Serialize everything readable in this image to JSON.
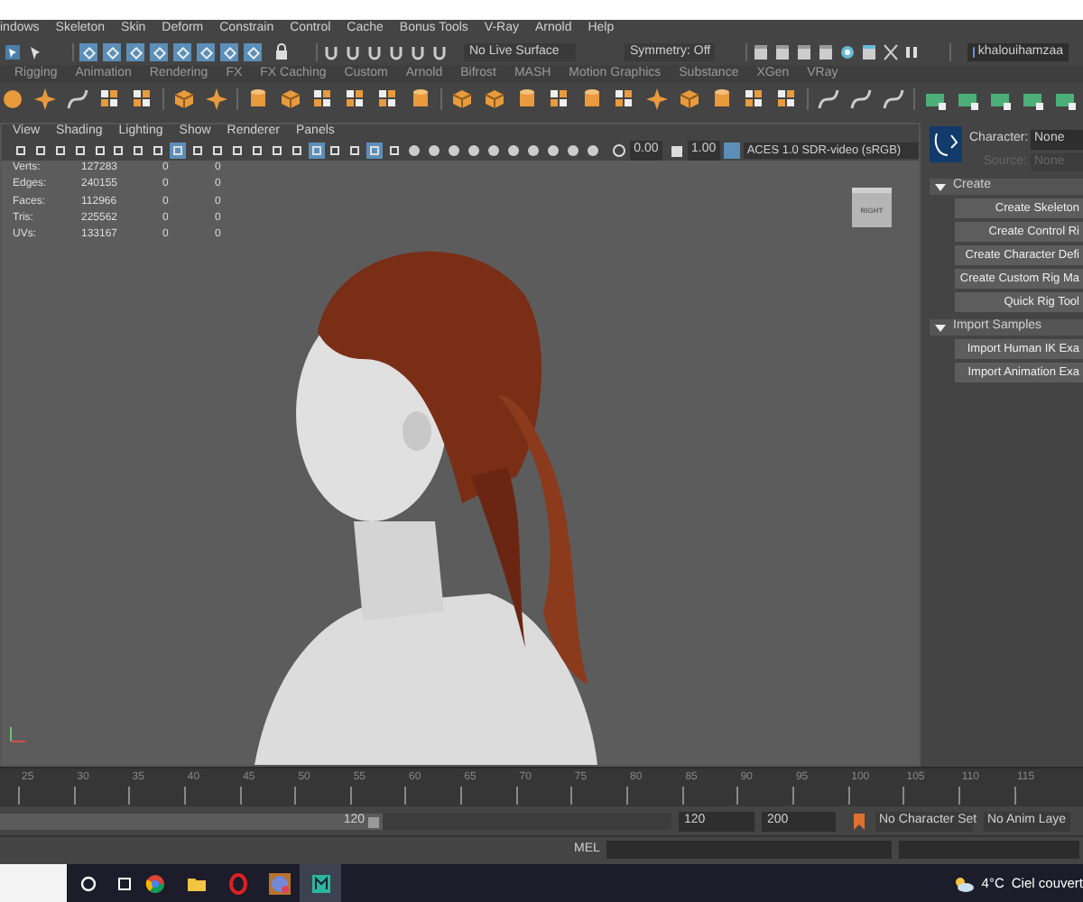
{
  "menu_bar": [
    "indows",
    "Skeleton",
    "Skin",
    "Deform",
    "Constrain",
    "Control",
    "Cache",
    "Bonus Tools",
    "V-Ray",
    "Arnold",
    "Help"
  ],
  "status_line": {
    "snap_tools": [
      {
        "on": true
      },
      {
        "on": true
      },
      {
        "on": true
      },
      {
        "on": true
      },
      {
        "on": true
      },
      {
        "on": true
      },
      {
        "on": true
      },
      {
        "on": true
      }
    ],
    "live_surface": "No Live Surface",
    "symmetry": "Symmetry: Off",
    "user": "khalouihamzaa"
  },
  "shelf_tabs": [
    "Rigging",
    "Animation",
    "Rendering",
    "FX",
    "FX Caching",
    "Custom",
    "Arnold",
    "Bifrost",
    "MASH",
    "Motion Graphics",
    "Substance",
    "XGen",
    "VRay"
  ],
  "viewport": {
    "menu": [
      "View",
      "Shading",
      "Lighting",
      "Show",
      "Renderer",
      "Panels"
    ],
    "toolbar_toggles": [
      {
        "on": false
      },
      {
        "on": false
      },
      {
        "on": false
      },
      {
        "on": false
      },
      {
        "on": false
      },
      {
        "on": false
      },
      {
        "on": false
      },
      {
        "on": false
      },
      {
        "on": true
      },
      {
        "on": false
      },
      {
        "on": false
      },
      {
        "on": false
      },
      {
        "on": false
      },
      {
        "on": false
      },
      {
        "on": false
      },
      {
        "on": true
      },
      {
        "on": false
      },
      {
        "on": false
      },
      {
        "on": true
      },
      {
        "on": false
      }
    ],
    "exposure": "0.00",
    "gamma": "1.00",
    "color_space": "ACES 1.0 SDR-video (sRGB)",
    "stats": [
      {
        "label": "Verts:",
        "values": [
          "127283",
          "0",
          "0"
        ]
      },
      {
        "label": "Edges:",
        "values": [
          "240155",
          "0",
          "0"
        ]
      },
      {
        "label": "Faces:",
        "values": [
          "112966",
          "0",
          "0"
        ]
      },
      {
        "label": "Tris:",
        "values": [
          "225562",
          "0",
          "0"
        ]
      },
      {
        "label": "UVs:",
        "values": [
          "133167",
          "0",
          "0"
        ]
      }
    ],
    "view_cube": "RIGHT"
  },
  "human_ik": {
    "character_label": "Character:",
    "character": "None",
    "source_label": "Source:",
    "source": "None",
    "sections": [
      {
        "title": "Create",
        "expanded": true,
        "buttons": [
          "Create Skeleton",
          "Create Control Ri",
          "Create Character Defi",
          "Create Custom Rig Ma",
          "Quick Rig Tool"
        ]
      },
      {
        "title": "Import Samples",
        "expanded": true,
        "buttons": [
          "Import Human IK Exa",
          "Import Animation Exa"
        ]
      }
    ]
  },
  "timeline": {
    "ticks": [
      "25",
      "30",
      "35",
      "40",
      "45",
      "50",
      "55",
      "60",
      "65",
      "70",
      "75",
      "80",
      "85",
      "90",
      "95",
      "100",
      "105",
      "110",
      "115"
    ]
  },
  "range": {
    "current": "120",
    "level": 1,
    "end": "120",
    "max": "200",
    "character_set": "No Character Set",
    "anim_layer": "No Anim Laye"
  },
  "command_line": {
    "language": "MEL"
  },
  "taskbar": {
    "apps": [
      {
        "selected": false
      },
      {
        "selected": false
      },
      {
        "selected": false
      },
      {
        "selected": false
      },
      {
        "selected": true
      }
    ],
    "temperature": "4°C",
    "condition": "Ciel couvert"
  }
}
